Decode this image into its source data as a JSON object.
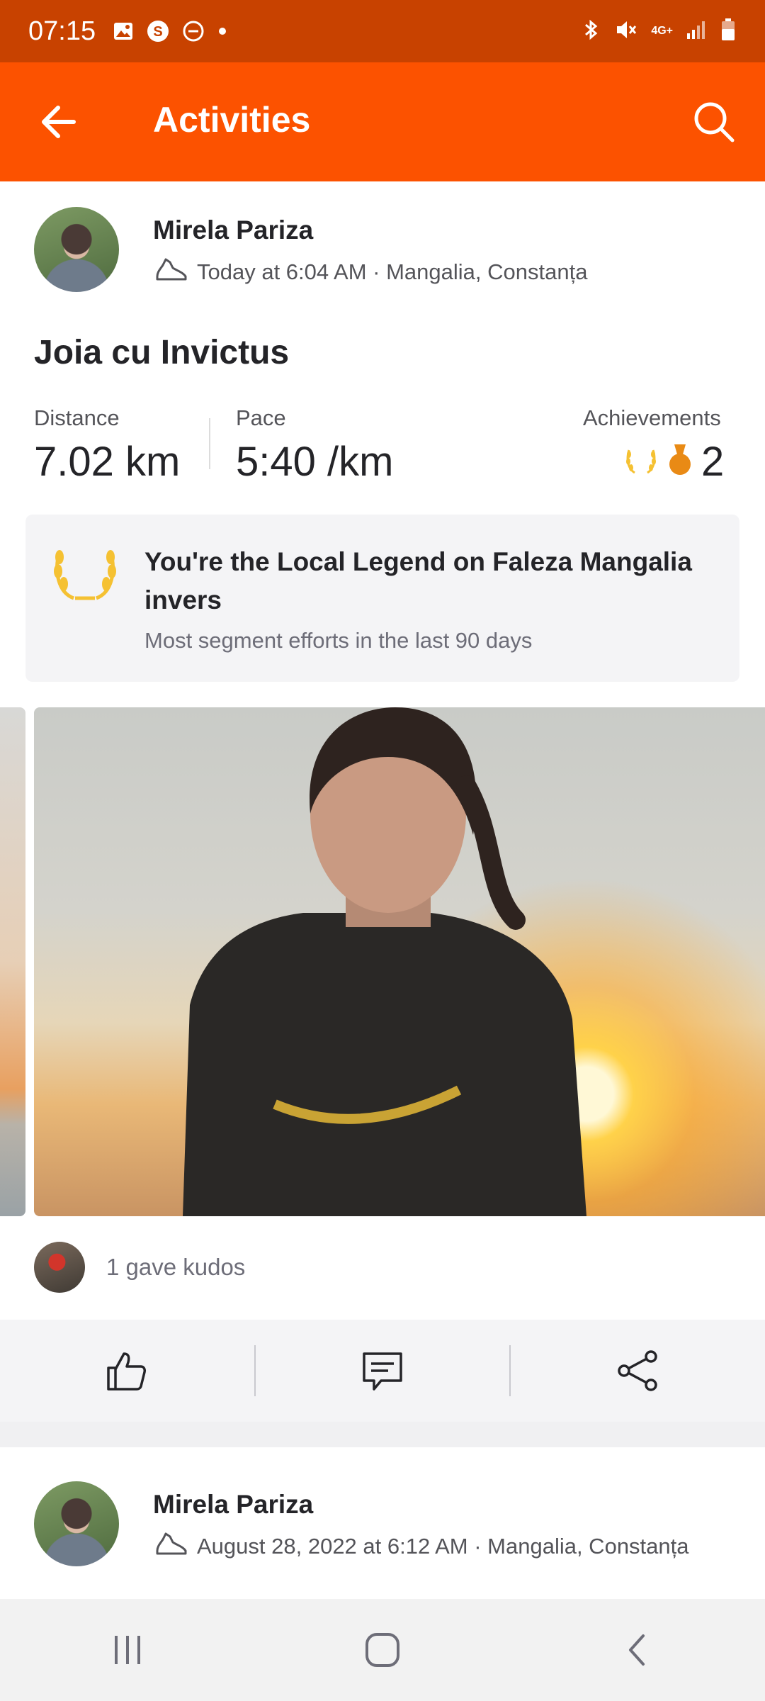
{
  "status_bar": {
    "time": "07:15",
    "network": "4G+",
    "left_icons": [
      "gallery-icon",
      "strava-s-icon",
      "do-not-disturb-icon",
      "dot-icon"
    ],
    "right_icons": [
      "bluetooth-icon",
      "mute-icon",
      "signal-icon",
      "battery-icon"
    ]
  },
  "app_bar": {
    "title": "Activities",
    "back_icon": "arrow-left-icon",
    "search_icon": "search-icon"
  },
  "activity": {
    "athlete_name": "Mirela Pariza",
    "timestamp_location": "Today at 6:04 AM · Mangalia, Constanța",
    "title": "Joia cu Invictus",
    "stats": [
      {
        "label": "Distance",
        "value": "7.02 km"
      },
      {
        "label": "Pace",
        "value": "5:40 /km"
      }
    ],
    "achievements": {
      "label": "Achievements",
      "count": "2"
    },
    "local_legend": {
      "title": "You're the Local Legend on Faleza Mangalia invers",
      "subtitle": "Most segment efforts in the last 90 days"
    },
    "kudos_text": "1 gave kudos",
    "actions": [
      "thumbs-up-icon",
      "comment-icon",
      "share-icon"
    ]
  },
  "next_activity": {
    "athlete_name": "Mirela Pariza",
    "timestamp_location": "August 28, 2022 at 6:12 AM · Mangalia, Constanța"
  },
  "colors": {
    "brand": "#fc5200",
    "status_bar": "#c84200",
    "gold": "#f5c132",
    "bronze": "#e98a15"
  }
}
